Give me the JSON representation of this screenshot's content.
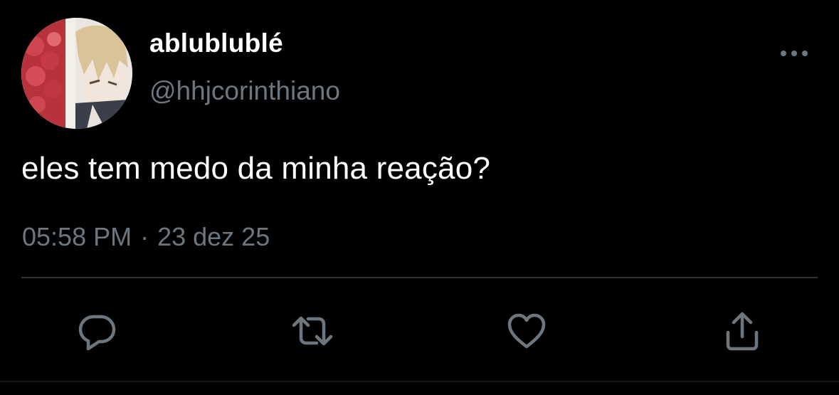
{
  "tweet": {
    "display_name": "ablublublé",
    "handle": "@hhjcorinthiano",
    "text": "eles tem medo da minha reação?",
    "time": "05:58 PM",
    "separator": "·",
    "date": "23 dez 25"
  },
  "icons": {
    "more": "more-dots-icon",
    "reply": "reply-icon",
    "retweet": "retweet-icon",
    "like": "heart-icon",
    "share": "share-icon"
  },
  "colors": {
    "background": "#000000",
    "text_primary": "#ffffff",
    "text_secondary": "#6e767d",
    "divider": "#2f3336",
    "icon": "#6e767d"
  }
}
